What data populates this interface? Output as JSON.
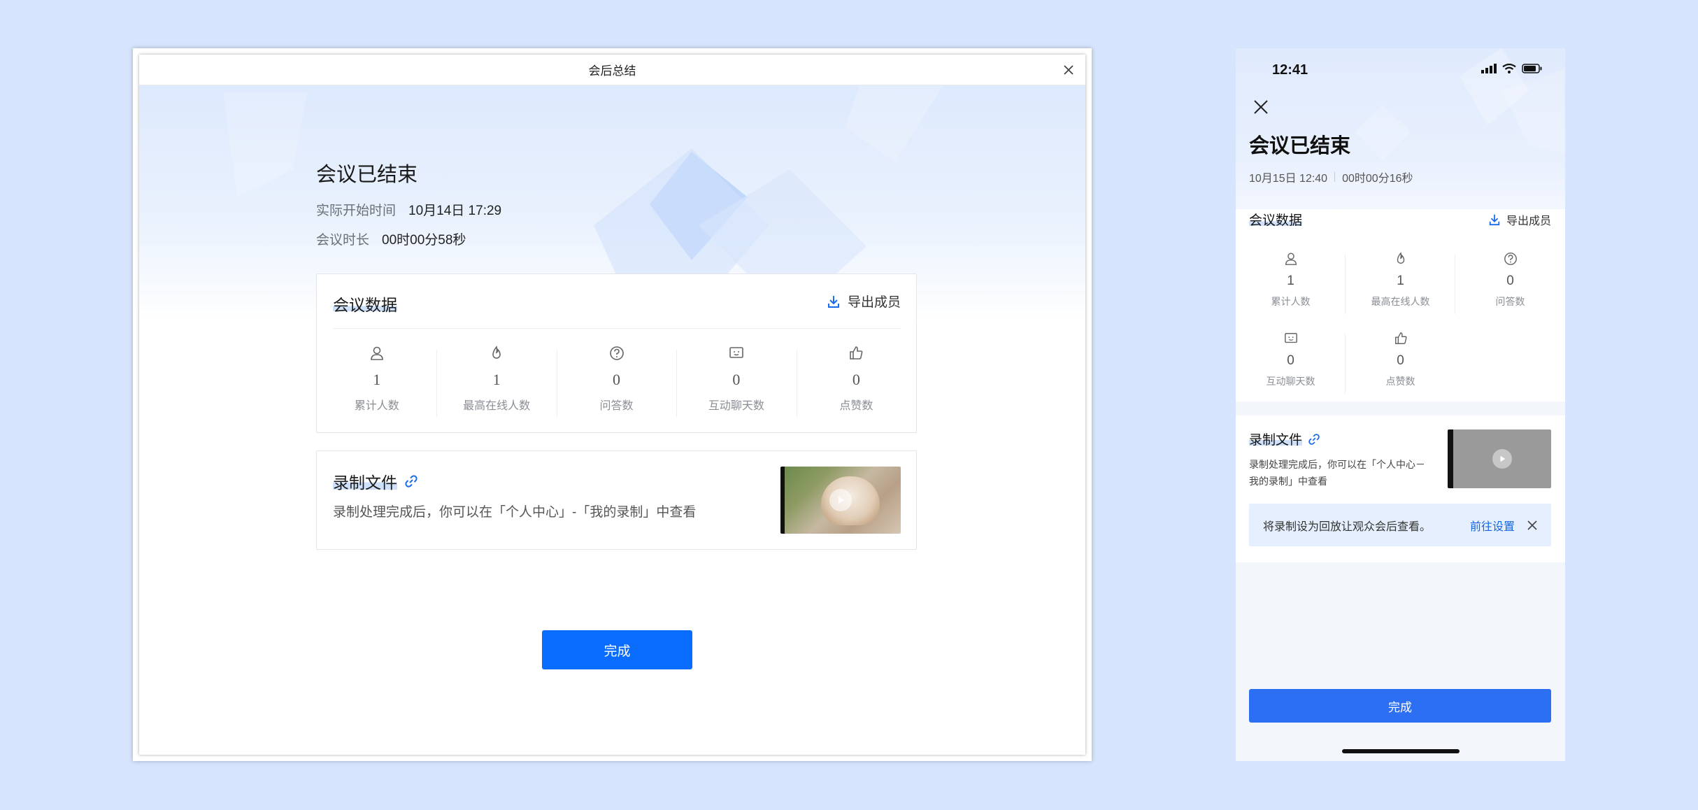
{
  "colors": {
    "background": "#d6e4fd",
    "primary": "#0a6cff",
    "mobile_primary": "#2d6ff2",
    "link": "#1565e0"
  },
  "desktop": {
    "window_title": "会后总结",
    "close_icon": "close-icon",
    "heading": "会议已结束",
    "start_time_label": "实际开始时间",
    "start_time_value": "10月14日 17:29",
    "duration_label": "会议时长",
    "duration_value": "00时00分58秒",
    "data_card": {
      "title": "会议数据",
      "export_label": "导出成员",
      "stats": [
        {
          "icon": "user-icon",
          "value": "1",
          "label": "累计人数"
        },
        {
          "icon": "fire-icon",
          "value": "1",
          "label": "最高在线人数"
        },
        {
          "icon": "question-icon",
          "value": "0",
          "label": "问答数"
        },
        {
          "icon": "chat-icon",
          "value": "0",
          "label": "互动聊天数"
        },
        {
          "icon": "thumbs-up-icon",
          "value": "0",
          "label": "点赞数"
        }
      ]
    },
    "record_card": {
      "title": "录制文件",
      "description": "录制处理完成后，你可以在「个人中心」-「我的录制」中查看"
    },
    "done_label": "完成"
  },
  "mobile": {
    "status_time": "12:41",
    "heading": "会议已结束",
    "date": "10月15日 12:40",
    "duration": "00时00分16秒",
    "data_title": "会议数据",
    "export_label": "导出成员",
    "stats": [
      {
        "icon": "user-icon",
        "value": "1",
        "label": "累计人数"
      },
      {
        "icon": "fire-icon",
        "value": "1",
        "label": "最高在线人数"
      },
      {
        "icon": "question-icon",
        "value": "0",
        "label": "问答数"
      },
      {
        "icon": "chat-icon",
        "value": "0",
        "label": "互动聊天数"
      },
      {
        "icon": "thumbs-up-icon",
        "value": "0",
        "label": "点赞数"
      }
    ],
    "record_title": "录制文件",
    "record_desc": "录制处理完成后，你可以在「个人中心－我的录制」中查看",
    "banner_text": "将录制设为回放让观众会后查看。",
    "banner_link": "前往设置",
    "done_label": "完成"
  }
}
